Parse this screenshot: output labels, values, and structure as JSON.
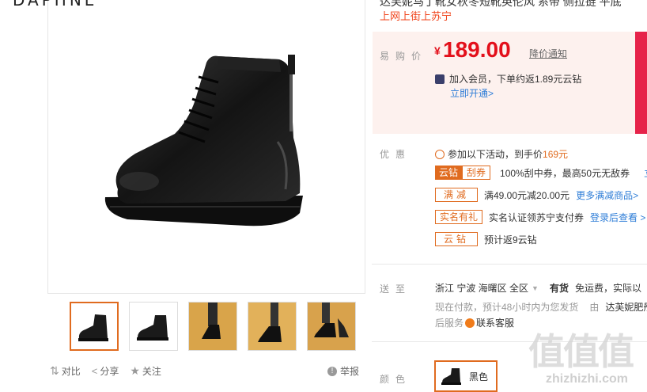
{
  "brand": "DAPHNE",
  "product": {
    "title_partial": "达芙妮马丁靴女秋冬短靴英伦风 系带 侧拉链 平底",
    "channel": "上网上街上苏宁",
    "price_label": "易购价",
    "currency": "¥",
    "price": "189.00",
    "price_notify": "降价通知",
    "member_text": "加入会员，下单约返1.89元云钻",
    "member_link": "立即开通>"
  },
  "promo": {
    "label": "优惠",
    "headline_prefix": "参加以下活动，到手价",
    "headline_price": "169元",
    "items": [
      {
        "tag": "云钻",
        "tag2": "刮券",
        "text": "100%刮中券，最高50元无敌券",
        "link": "立"
      },
      {
        "tag": "满减",
        "text": "满49.00元减20.00元",
        "link": "更多满减商品>"
      },
      {
        "tag": "实名有礼",
        "text": "实名认证领苏宁支付券",
        "link": "登录后查看 >"
      },
      {
        "tag": "云钻",
        "text": "预计返9云钻",
        "link": ""
      }
    ]
  },
  "delivery": {
    "label": "送至",
    "location": "浙江  宁波  海曙区  全区",
    "stock": "有货",
    "freight": "免运费，实际以",
    "shipping_note": "现在付款，预计48小时内为您发货",
    "seller_prefix": "由",
    "seller": "达芙妮肥彤",
    "aftersale_label": "后服务",
    "contact": "联系客服"
  },
  "color": {
    "label": "颜色",
    "selected": "黑色"
  },
  "actions": {
    "compare": "对比",
    "share": "分享",
    "follow": "关注",
    "report": "举报"
  },
  "thumbnails": [
    {
      "name": "thumb-1",
      "bg": "#ffffff"
    },
    {
      "name": "thumb-2",
      "bg": "#ffffff"
    },
    {
      "name": "thumb-3",
      "bg": "#d9a44a"
    },
    {
      "name": "thumb-4",
      "bg": "#e2b15a"
    },
    {
      "name": "thumb-5",
      "bg": "#d8a24c"
    }
  ],
  "watermark": {
    "text": "值值值",
    "url": "zhizhizhi.com"
  },
  "colors": {
    "accent": "#e06b1f",
    "price_red": "#e3101b",
    "link_blue": "#2e7dd7",
    "price_bg": "#fdf1ee"
  }
}
